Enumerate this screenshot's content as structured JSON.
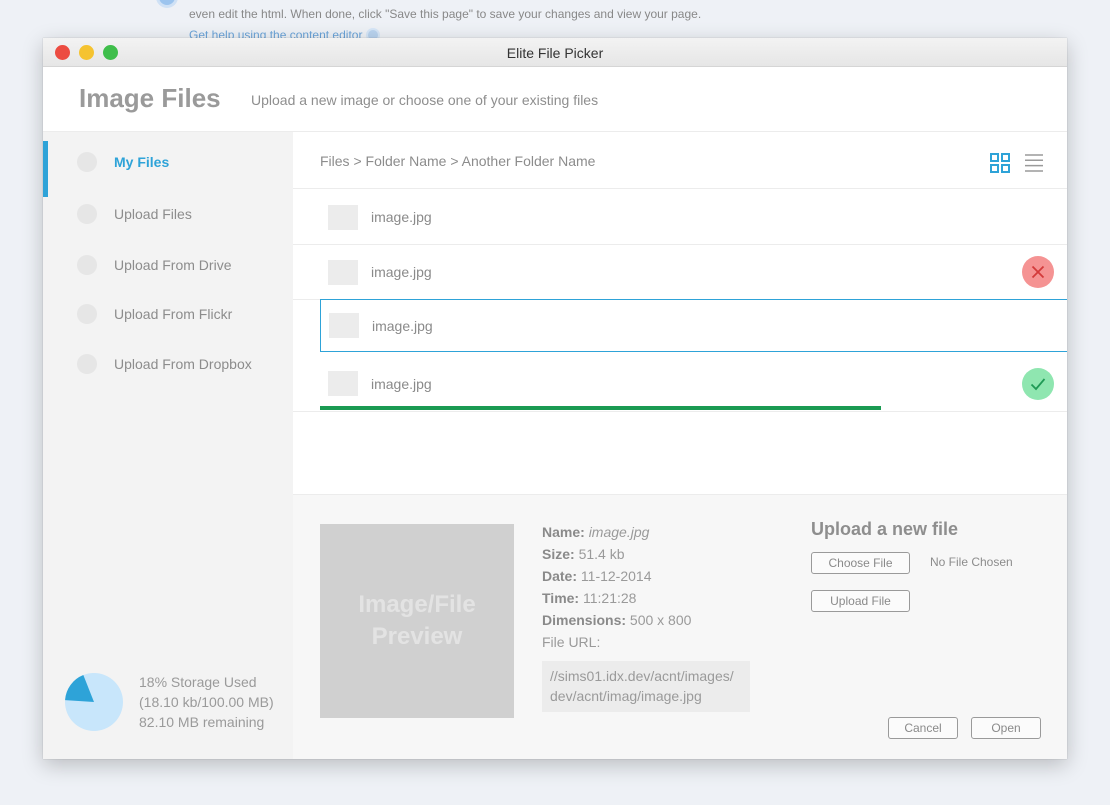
{
  "background": {
    "text": "even edit the html. When done, click \"Save this page\" to save your changes and view your page.",
    "help_link": "Get help using the content editor"
  },
  "window": {
    "title": "Elite File Picker"
  },
  "header": {
    "title": "Image Files",
    "subtitle": "Upload a new image or choose one of your existing files"
  },
  "sidebar": {
    "items": [
      {
        "label": "My Files",
        "active": true
      },
      {
        "label": "Upload Files",
        "active": false
      },
      {
        "label": "Upload From Drive",
        "active": false
      },
      {
        "label": "Upload From Flickr",
        "active": false
      },
      {
        "label": "Upload From Dropbox",
        "active": false
      }
    ],
    "storage": {
      "line1": "18% Storage Used",
      "line2": "(18.10 kb/100.00 MB)",
      "line3": "82.10 MB remaining",
      "percent_used": 18,
      "used_color": "#2ea3d8",
      "free_color": "#c8e6fb"
    }
  },
  "main": {
    "breadcrumb": "Files > Folder Name > Another Folder Name",
    "files": [
      {
        "name": "image.jpg",
        "status": "none"
      },
      {
        "name": "image.jpg",
        "status": "error"
      },
      {
        "name": "image.jpg",
        "status": "selected"
      },
      {
        "name": "image.jpg",
        "status": "complete",
        "upload_progress": 0.75
      }
    ]
  },
  "details": {
    "preview_line1": "Image/File",
    "preview_line2": "Preview",
    "name_label": "Name:",
    "name_value": "image.jpg",
    "size_label": "Size:",
    "size_value": "51.4 kb",
    "date_label": "Date:",
    "date_value": "11-12-2014",
    "time_label": "Time:",
    "time_value": "11:21:28",
    "dimensions_label": "Dimensions:",
    "dimensions_value": "500 x 800",
    "url_label": "File URL:",
    "url_line1": "//sims01.idx.dev/acnt/images/",
    "url_line2": "dev/acnt/imag/image.jpg"
  },
  "upload": {
    "title": "Upload a new file",
    "choose_label": "Choose File",
    "no_file_label": "No File Chosen",
    "upload_label": "Upload File"
  },
  "footer": {
    "cancel_label": "Cancel",
    "open_label": "Open"
  }
}
